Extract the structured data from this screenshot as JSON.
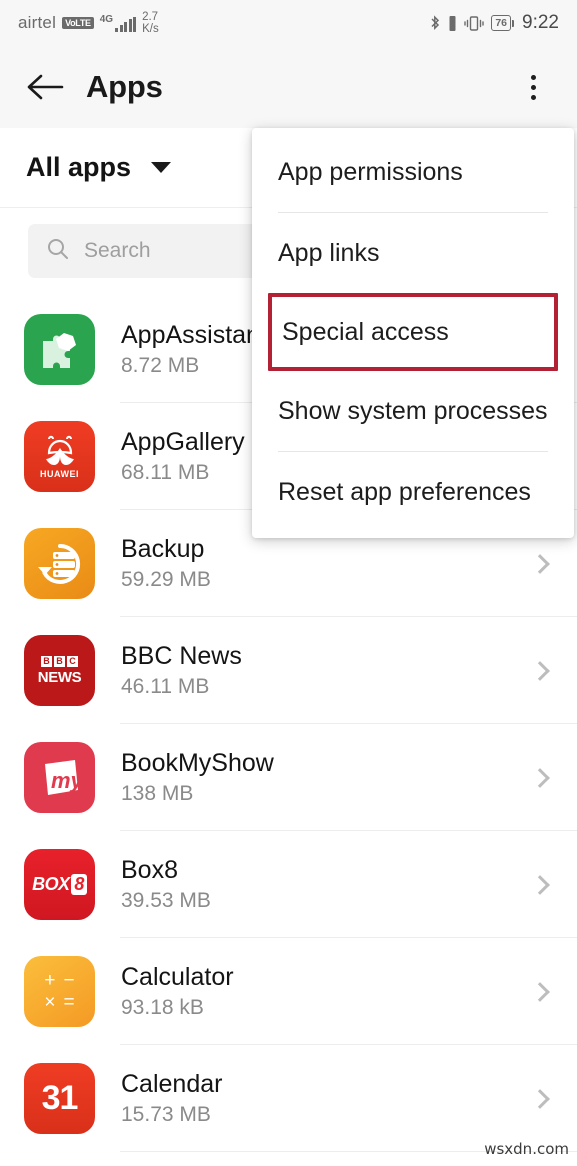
{
  "status_bar": {
    "carrier": "airtel",
    "volte_badge": "VoLTE",
    "network_type": "4G",
    "net_speed_value": "2.7",
    "net_speed_unit": "K/s",
    "bluetooth_icon": "bluetooth-icon",
    "bluetooth_battery_icon": "bluetooth-battery-icon",
    "vibrate_icon": "vibrate-icon",
    "battery_level": "76",
    "clock": "9:22"
  },
  "app_bar": {
    "back_icon": "back-arrow-icon",
    "title": "Apps",
    "overflow_icon": "overflow-menu-icon"
  },
  "filter": {
    "label": "All apps",
    "caret_icon": "chevron-down-icon"
  },
  "search": {
    "icon": "search-icon",
    "placeholder": "Search",
    "value": ""
  },
  "overflow_menu": {
    "visible": true,
    "highlight_color": "#b22234",
    "items": [
      {
        "label": "App permissions",
        "highlighted": false
      },
      {
        "label": "App links",
        "highlighted": false
      },
      {
        "label": "Special access",
        "highlighted": true
      },
      {
        "label": "Show system processes",
        "highlighted": false
      },
      {
        "label": "Reset app preferences",
        "highlighted": false
      }
    ]
  },
  "app_list": {
    "chevron_icon": "chevron-right-icon",
    "items": [
      {
        "name": "AppAssistant",
        "size": "8.72 MB",
        "icon": "appassistant-icon"
      },
      {
        "name": "AppGallery",
        "size": "68.11 MB",
        "icon": "appgallery-icon"
      },
      {
        "name": "Backup",
        "size": "59.29 MB",
        "icon": "backup-icon"
      },
      {
        "name": "BBC News",
        "size": "46.11 MB",
        "icon": "bbc-news-icon"
      },
      {
        "name": "BookMyShow",
        "size": "138 MB",
        "icon": "bookmyshow-icon"
      },
      {
        "name": "Box8",
        "size": "39.53 MB",
        "icon": "box8-icon"
      },
      {
        "name": "Calculator",
        "size": "93.18 kB",
        "icon": "calculator-icon"
      },
      {
        "name": "Calendar",
        "size": "15.73 MB",
        "icon": "calendar-icon"
      }
    ]
  },
  "watermark": {
    "text": "wsxdn.com"
  }
}
